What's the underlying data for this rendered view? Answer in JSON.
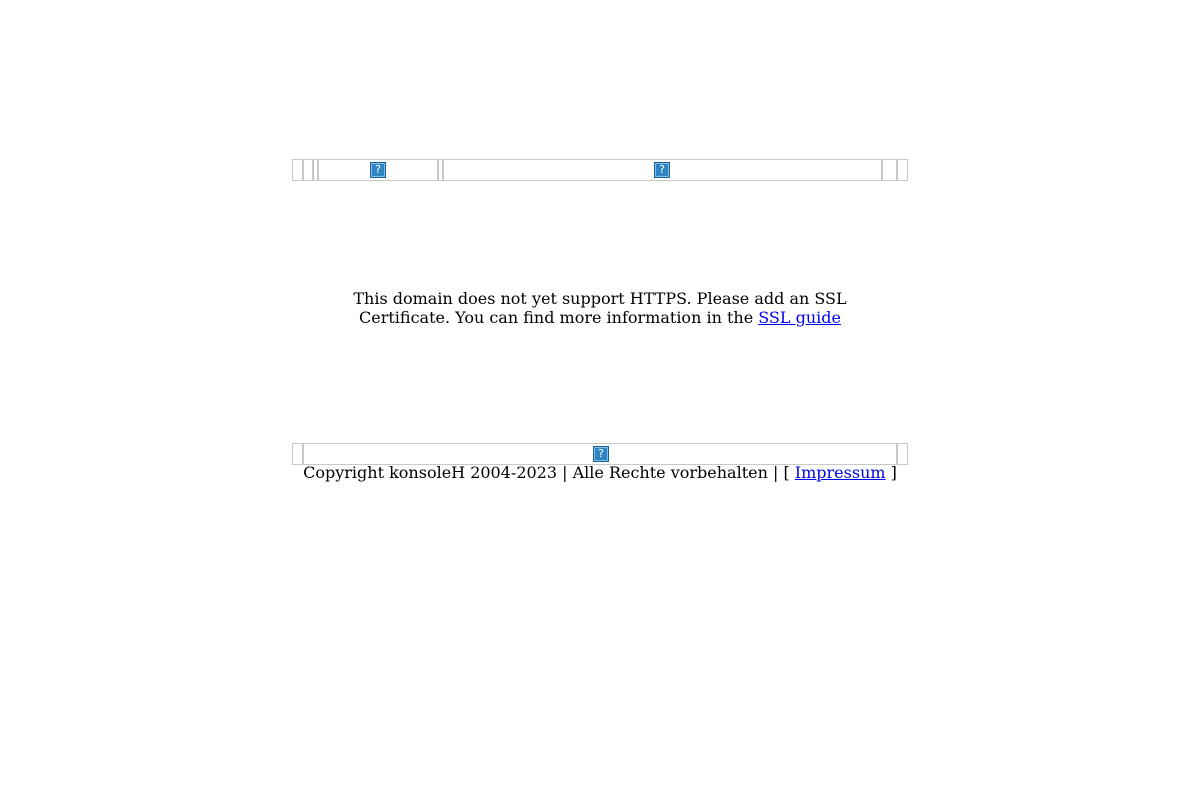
{
  "message": {
    "line1": "This domain does not yet support HTTPS. Please add an SSL",
    "line2": "Certificate. You can find more information in the ",
    "link_label": "SSL guide"
  },
  "footer": {
    "copyright": "Copyright konsoleH 2004-2023 | Alle Rechte vorbehalten | [ ",
    "link_label": "Impressum",
    "suffix": " ]"
  },
  "icons": {
    "broken_image_glyph": "?",
    "broken_image_color": "#2f84c2"
  }
}
